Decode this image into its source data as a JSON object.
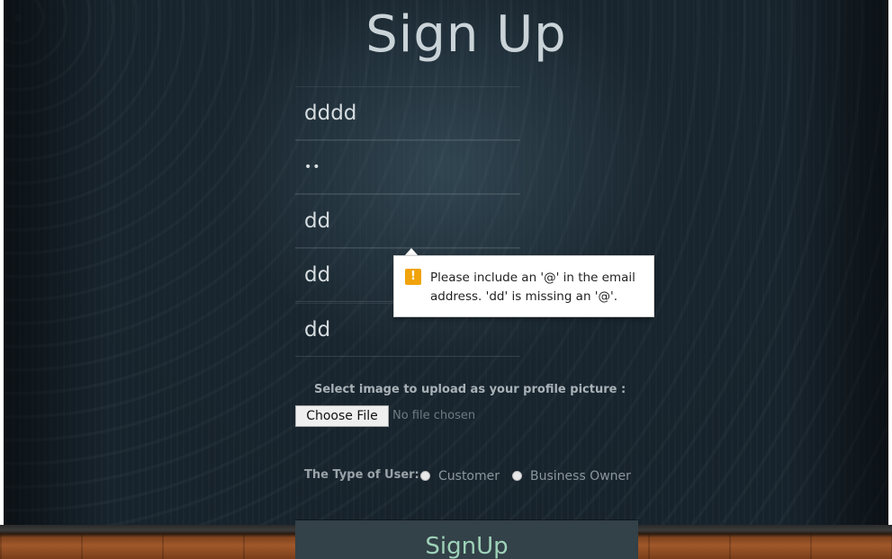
{
  "page": {
    "title": "Sign Up"
  },
  "form": {
    "fields": [
      {
        "value": "dddd"
      },
      {
        "value": "••"
      },
      {
        "value": "dd"
      },
      {
        "value": "dd"
      },
      {
        "value": "dd"
      }
    ],
    "upload_label": "Select image to upload as your profile picture :",
    "choose_file_label": "Choose File",
    "no_file_text": "No file chosen",
    "user_type_label": "The Type of User:",
    "user_type_options": [
      "Customer",
      "Business Owner"
    ],
    "submit_label": "SignUp"
  },
  "validation_tooltip": {
    "icon": "warning-icon",
    "icon_glyph": "!",
    "message": "Please include an '@' in the email address. 'dd' is missing an '@'."
  },
  "colors": {
    "title": "#c9d3d8",
    "submit_bg": "#334148",
    "submit_text": "#9ed2b8",
    "warning": "#f0a30a"
  }
}
